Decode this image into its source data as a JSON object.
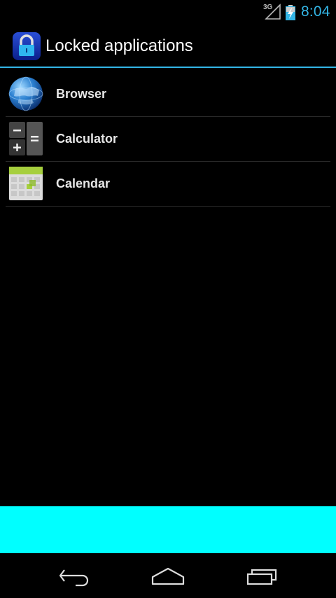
{
  "status_bar": {
    "network_type": "3G",
    "time": "8:04",
    "icons": [
      "signal-icon",
      "battery-charging-icon"
    ],
    "clock_color": "#33b5e5"
  },
  "action_bar": {
    "title": "Locked applications",
    "icon": "lock-icon",
    "accent_color": "#33b5e5"
  },
  "apps": [
    {
      "label": "Browser",
      "icon": "browser-globe-icon"
    },
    {
      "label": "Calculator",
      "icon": "calculator-icon"
    },
    {
      "label": "Calendar",
      "icon": "calendar-icon"
    }
  ],
  "banner": {
    "color": "#00ffff"
  },
  "nav_bar": {
    "icons": [
      "back-icon",
      "home-icon",
      "recent-apps-icon"
    ]
  }
}
